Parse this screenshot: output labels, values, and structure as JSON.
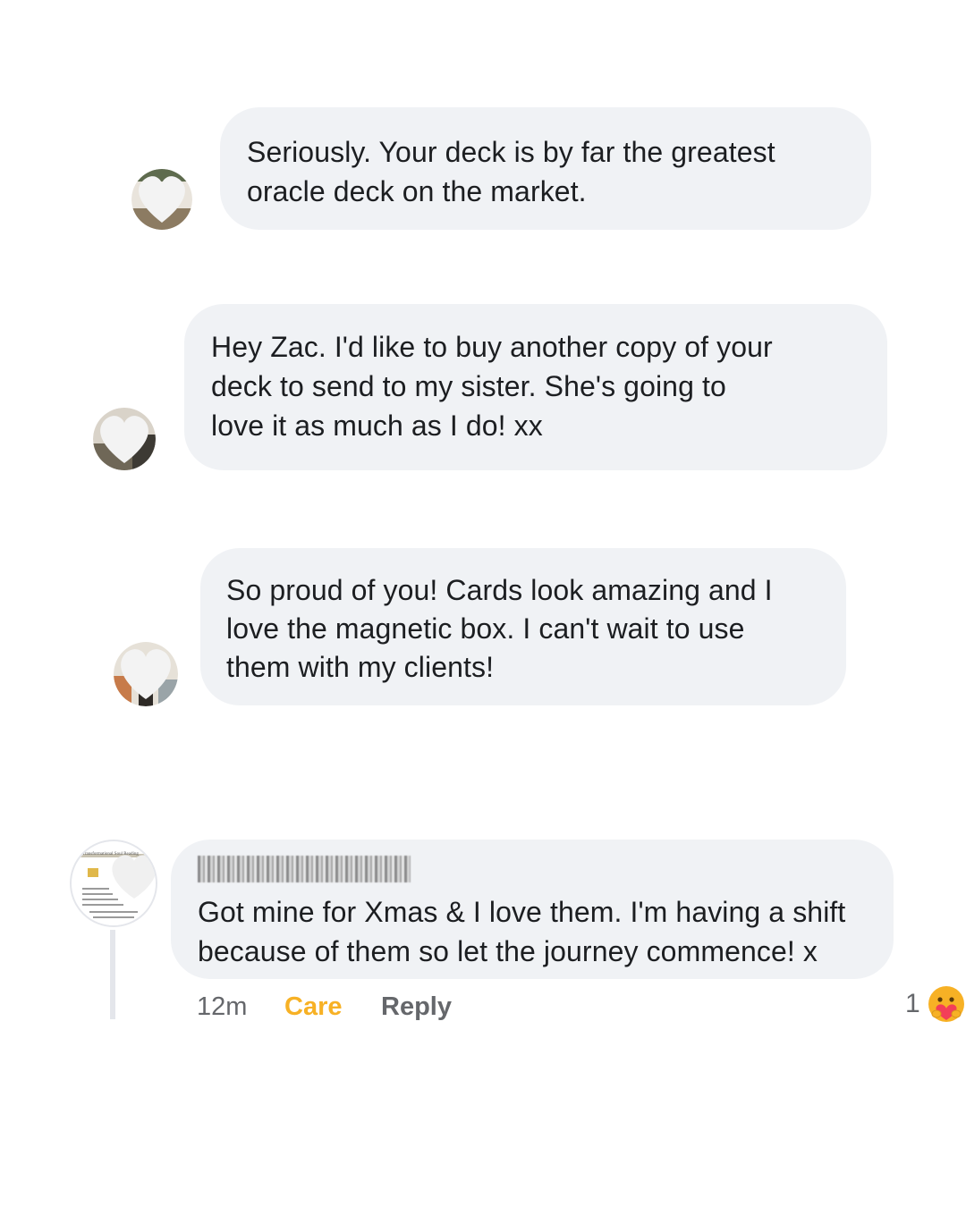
{
  "comments": [
    {
      "text_lines": [
        "Seriously. Your deck is by far the greatest",
        "oracle deck on the market."
      ],
      "avatar_icon": "profile-avatar-icon"
    },
    {
      "text_lines": [
        "Hey Zac. I'd like to buy another copy of your",
        "deck to send to my sister. She's going to",
        "love it as much as I do! xx"
      ],
      "avatar_icon": "profile-avatar-icon"
    },
    {
      "text_lines": [
        "So proud of you! Cards look amazing and I",
        "love the magnetic box. I can't wait to use",
        "them with my clients!"
      ],
      "avatar_icon": "profile-avatar-icon"
    }
  ],
  "reply_comment": {
    "author_redacted": true,
    "text_lines": [
      "Got mine for Xmas & I love them. I'm having a shift",
      "because of them so let the journey commence! x"
    ],
    "avatar_caption": "Transformational Soul Reading",
    "actions": {
      "time": "12m",
      "reaction_label": "Care",
      "reply_label": "Reply"
    },
    "reaction_summary": {
      "count": "1",
      "emoji_icon": "care-reaction-icon"
    }
  },
  "colors": {
    "bubble_bg": "#f0f2f5",
    "text": "#1c1e21",
    "meta_text": "#65676b",
    "care_color": "#f7b125"
  }
}
